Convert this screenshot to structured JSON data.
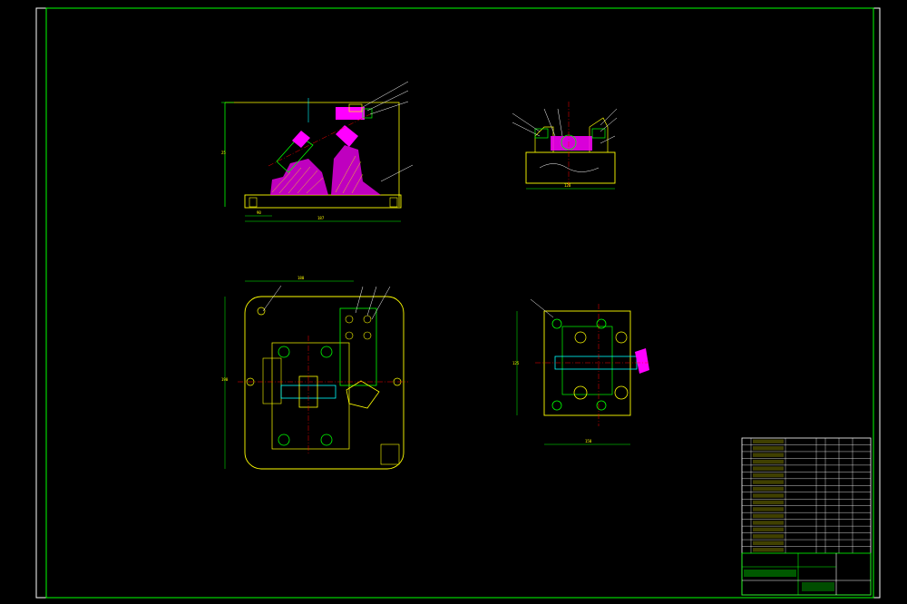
{
  "colors": {
    "background": "#000000",
    "frame": "#00ff00",
    "outline": "#ffff00",
    "centerline": "#ff0000",
    "section_fill": "#ff00ff",
    "white": "#ffffff",
    "cyan": "#00ffff",
    "green": "#00ff00"
  },
  "views": {
    "front": {
      "dims": [
        "90",
        "187",
        "25"
      ]
    },
    "side": {
      "dims": [
        "120"
      ]
    },
    "plan": {
      "dims": [
        "180",
        "190"
      ]
    },
    "right_plan": {
      "dims": [
        "150",
        "125"
      ]
    }
  },
  "title_block": {
    "bom_rows": 17
  }
}
